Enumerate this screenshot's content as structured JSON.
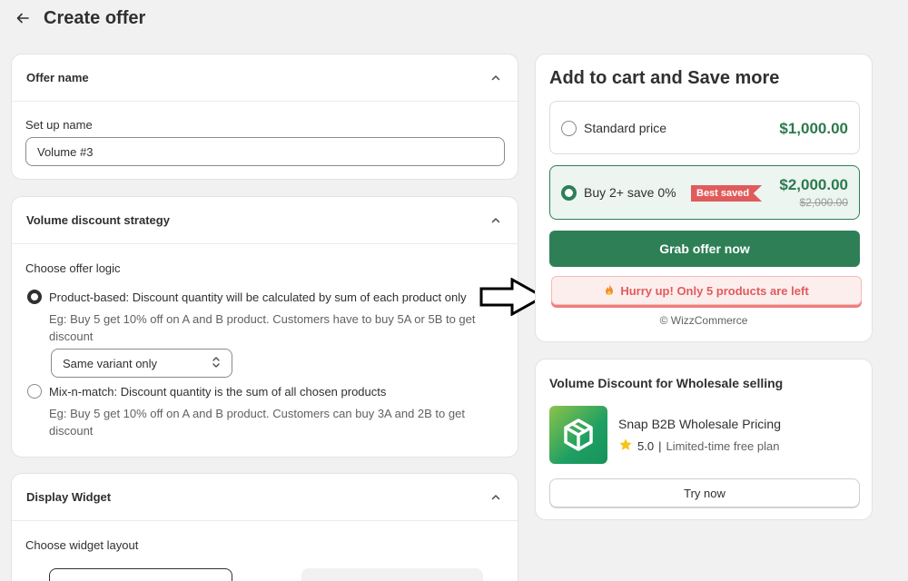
{
  "header": {
    "title": "Create offer"
  },
  "offer_name": {
    "section_title": "Offer name",
    "field_label": "Set up name",
    "field_value": "Volume #3"
  },
  "strategy": {
    "section_title": "Volume discount strategy",
    "logic_label": "Choose offer logic",
    "options": [
      {
        "label": "Product-based: Discount quantity will be calculated by sum of each product only",
        "help_1": "Eg: Buy 5 get 10% off on A and B product. Customers have to buy 5A or 5B to get",
        "help_2": "discount",
        "selected": true
      },
      {
        "label": "Mix-n-match: Discount quantity is the sum of all chosen products",
        "help_1": "Eg: Buy 5 get 10% off on A and B product. Customers can buy 3A and 2B to get",
        "help_2": "discount",
        "selected": false
      }
    ],
    "variant_select": "Same variant only"
  },
  "display_widget": {
    "section_title": "Display Widget",
    "layout_label": "Choose widget layout"
  },
  "preview": {
    "title": "Add to cart and Save more",
    "standard_label": "Standard price",
    "standard_price": "$1,000.00",
    "bundle_label": "Buy 2+ save 0%",
    "badge": "Best saved",
    "bundle_price": "$2,000.00",
    "bundle_original": "$2,000.00",
    "cta": "Grab offer now",
    "hurry": "Hurry up! Only 5 products are left",
    "powered_by": "© WizzCommerce"
  },
  "promo": {
    "title": "Volume Discount for Wholesale selling",
    "app_name": "Snap B2B Wholesale Pricing",
    "rating": "5.0",
    "plan": "Limited-time free plan",
    "cta": "Try now"
  },
  "colors": {
    "accent_green": "#2e7f56",
    "price_green": "#2c7a4f",
    "badge_red": "#e05b5b",
    "selected_row_bg": "#edf5f1"
  },
  "icons": [
    "back-arrow-icon",
    "chevron-up-icon",
    "select-arrows-icon",
    "fire-icon",
    "star-icon",
    "app-logo-icon",
    "pointer-arrow-icon"
  ]
}
